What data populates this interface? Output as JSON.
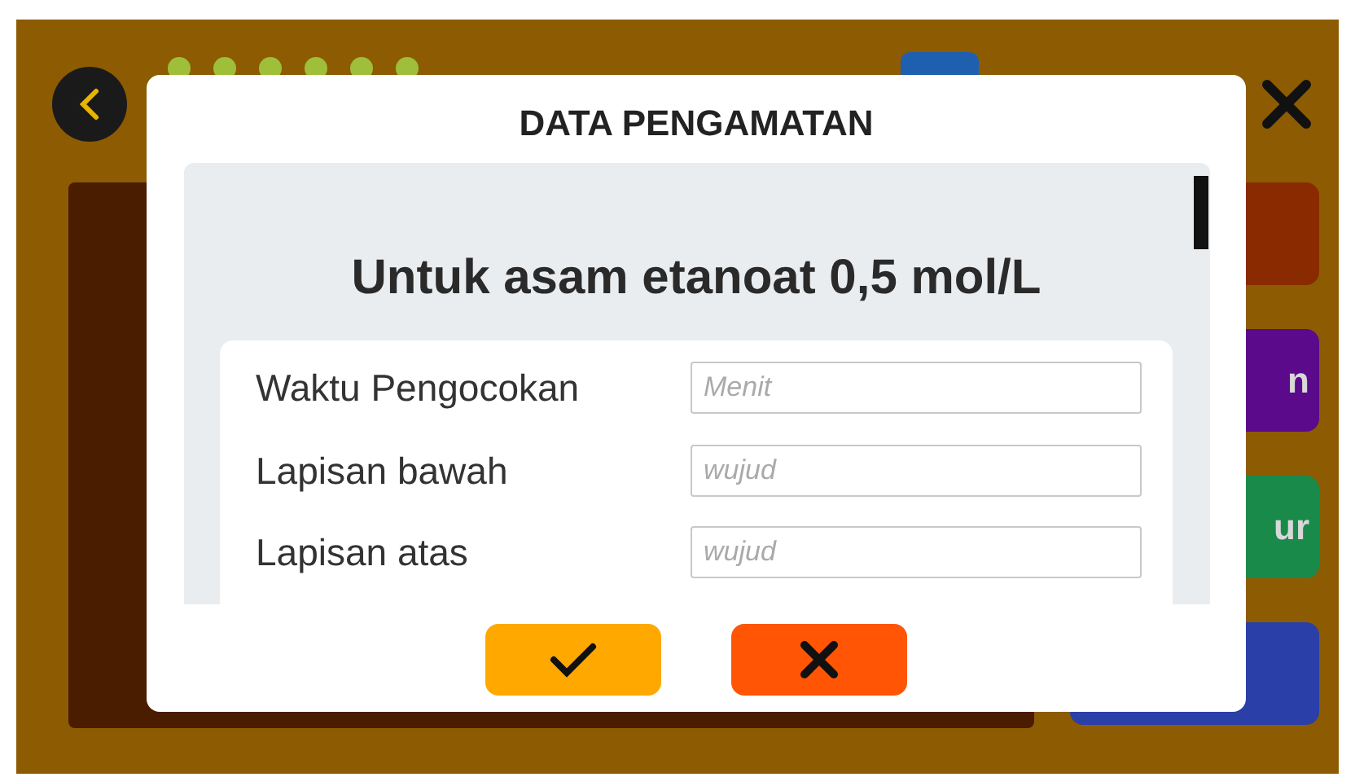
{
  "side_buttons": [
    {
      "color": "#8a2a00"
    },
    {
      "label": "n",
      "color": "#5a0a8a"
    },
    {
      "label": "ur",
      "color": "#1a8a4a"
    },
    {
      "color": "#2a3fa8"
    }
  ],
  "dialog": {
    "title": "DATA PENGAMATAN",
    "heading": "Untuk asam etanoat 0,5 mol/L",
    "fields": [
      {
        "label": "Waktu Pengocokan",
        "placeholder": "Menit"
      },
      {
        "label": "Lapisan bawah",
        "placeholder": "wujud"
      },
      {
        "label": "Lapisan atas",
        "placeholder": "wujud"
      }
    ],
    "buttons": [
      {
        "kind": "confirm"
      },
      {
        "kind": "cancel"
      }
    ]
  }
}
